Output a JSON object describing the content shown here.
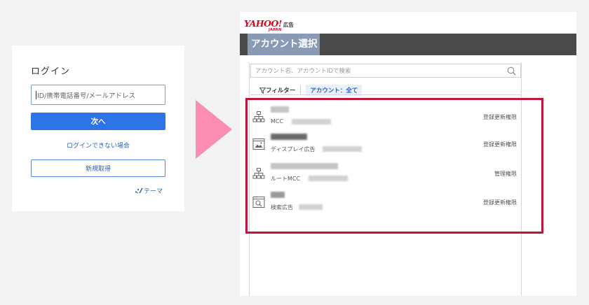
{
  "login": {
    "title": "ログイン",
    "input_value": "ID/携帯電話番号/メールアドレス",
    "next_button": "次へ",
    "cant_login_link": "ログインできない場合",
    "signup_button": "新規取得",
    "theme_link": "テーマ"
  },
  "brand": {
    "logo": "YAHOO!",
    "logo_sub": "JAPAN",
    "product": "広告"
  },
  "panel": {
    "title": "アカウント選択",
    "search_placeholder": "アカウント名、アカウントIDで検索",
    "filter_label": "フィルター",
    "filter_chip": "アカウント：全て"
  },
  "accounts": [
    {
      "icon": "hierarchy-icon",
      "type": "MCC",
      "permission": "登録更新権限"
    },
    {
      "icon": "display-ad-icon",
      "type": "ディスプレイ広告",
      "permission": "登録更新権限"
    },
    {
      "icon": "hierarchy-icon",
      "type": "ルートMCC",
      "permission": "管理権限"
    },
    {
      "icon": "search-ad-icon",
      "type": "検索広告",
      "permission": "登録更新権限"
    }
  ],
  "colors": {
    "primary_button": "#2d74e8",
    "header_bar": "#4a4a4a",
    "highlight_box": "#c0143c",
    "arrow": "#fb8db0",
    "logo_red": "#e0001e"
  }
}
